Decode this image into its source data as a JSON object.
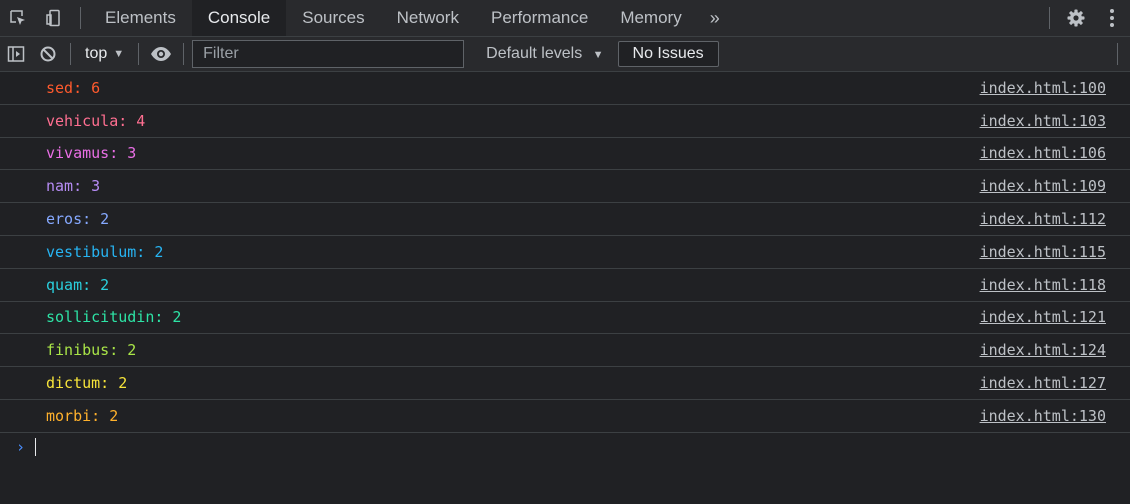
{
  "tabs": [
    {
      "label": "Elements"
    },
    {
      "label": "Console"
    },
    {
      "label": "Sources"
    },
    {
      "label": "Network"
    },
    {
      "label": "Performance"
    },
    {
      "label": "Memory"
    }
  ],
  "more_tabs": "»",
  "toolbar": {
    "context": "top",
    "filter_placeholder": "Filter",
    "levels": "Default levels",
    "issues": "No Issues"
  },
  "colors": {
    "background": "#202124",
    "toolbar": "#292a2d",
    "link": "#bdc1c6",
    "prompt": "#4a8fff"
  },
  "console": {
    "rows": [
      {
        "text": "sed: 6",
        "source": "index.html:100",
        "color": "#ff5a2d"
      },
      {
        "text": "vehicula: 4",
        "source": "index.html:103",
        "color": "#ff6f91"
      },
      {
        "text": "vivamus: 3",
        "source": "index.html:106",
        "color": "#ea6fe6"
      },
      {
        "text": "nam: 3",
        "source": "index.html:109",
        "color": "#b68cf5"
      },
      {
        "text": "eros: 2",
        "source": "index.html:112",
        "color": "#86a9ff"
      },
      {
        "text": "vestibulum: 2",
        "source": "index.html:115",
        "color": "#27b4f2"
      },
      {
        "text": "quam: 2",
        "source": "index.html:118",
        "color": "#2ad0de"
      },
      {
        "text": "sollicitudin: 2",
        "source": "index.html:121",
        "color": "#2de3a5"
      },
      {
        "text": "finibus: 2",
        "source": "index.html:124",
        "color": "#a9e548"
      },
      {
        "text": "dictum: 2",
        "source": "index.html:127",
        "color": "#f6e43a"
      },
      {
        "text": "morbi: 2",
        "source": "index.html:130",
        "color": "#ffb12c"
      }
    ]
  }
}
